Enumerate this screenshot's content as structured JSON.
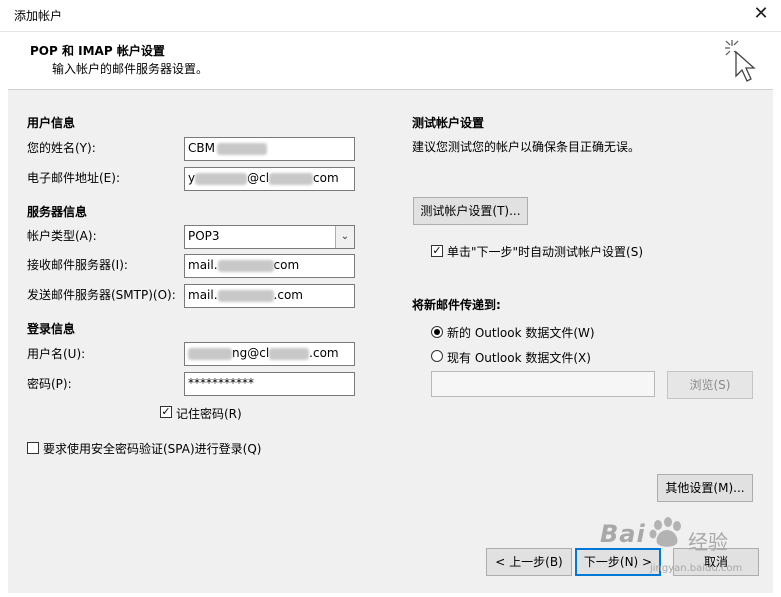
{
  "window": {
    "title": "添加帐户",
    "close_glyph": "✕"
  },
  "header": {
    "title": "POP 和 IMAP 帐户设置",
    "subtitle": "输入帐户的邮件服务器设置。",
    "icon": "cursor-sparkle-icon"
  },
  "user_info": {
    "section": "用户信息",
    "name_label": "您的姓名(Y):",
    "name_value": "CBM",
    "email_label": "电子邮件地址(E):",
    "email_value_prefix": "y",
    "email_value_mid": "@cl",
    "email_value_suffix": "com"
  },
  "server_info": {
    "section": "服务器信息",
    "account_type_label": "帐户类型(A):",
    "account_type_value": "POP3",
    "incoming_label": "接收邮件服务器(I):",
    "incoming_prefix": "mail.",
    "incoming_suffix": "com",
    "outgoing_label": "发送邮件服务器(SMTP)(O):",
    "outgoing_prefix": "mail.",
    "outgoing_suffix": ".com"
  },
  "login_info": {
    "section": "登录信息",
    "username_label": "用户名(U):",
    "username_mid": "ng@cl",
    "username_suffix": ".com",
    "password_label": "密码(P):",
    "password_value": "***********",
    "remember_label": "记住密码(R)",
    "remember_checked": true,
    "spa_label": "要求使用安全密码验证(SPA)进行登录(Q)",
    "spa_checked": false
  },
  "test": {
    "section": "测试帐户设置",
    "desc": "建议您测试您的帐户以确保条目正确无误。",
    "button": "测试帐户设置(T)...",
    "auto_test_label": "单击\"下一步\"时自动测试帐户设置(S)",
    "auto_test_checked": true
  },
  "deliver": {
    "section": "将新邮件传递到:",
    "new_file_label": "新的 Outlook 数据文件(W)",
    "existing_file_label": "现有 Outlook 数据文件(X)",
    "selected": "new",
    "browse_button": "浏览(S)"
  },
  "more_settings": "其他设置(M)...",
  "nav": {
    "back": "< 上一步(B)",
    "next": "下一步(N) >",
    "cancel": "取消"
  },
  "watermark": {
    "brand": "Bai",
    "suffix": "经验",
    "url": "jingyan.baidu.com"
  },
  "colors": {
    "accent": "#0078d7",
    "body_bg": "#f0f0f0"
  }
}
